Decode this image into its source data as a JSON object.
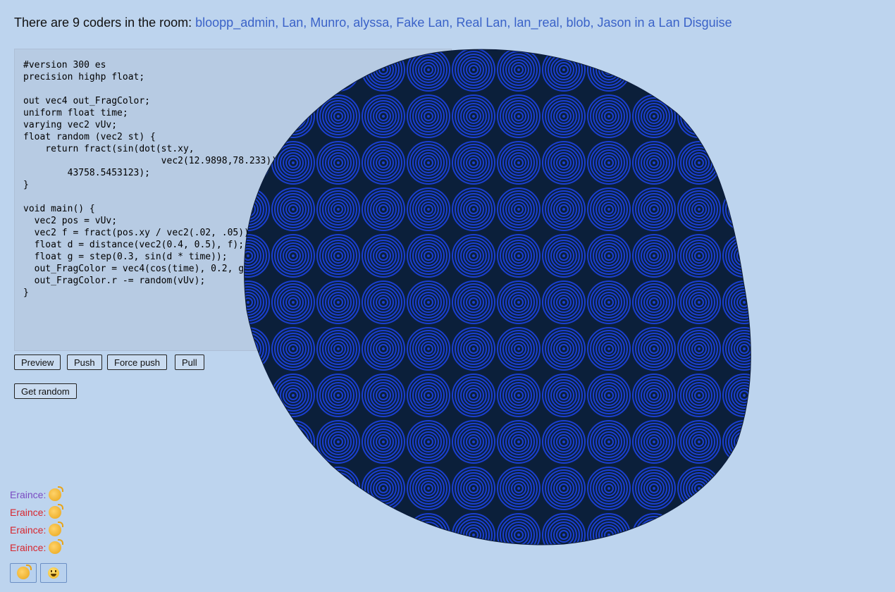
{
  "header": {
    "prefix": "There are 9 coders in the room:",
    "coders": "bloopp_admin, Lan, Munro, alyssa, Fake Lan, Real Lan, lan_real, blob, Jason in a Lan Disguise"
  },
  "editor": {
    "code": "#version 300 es\nprecision highp float;\n\nout vec4 out_FragColor;\nuniform float time;\nvarying vec2 vUv;\nfloat random (vec2 st) {\n    return fract(sin(dot(st.xy,\n                         vec2(12.9898,78.233)))*\n        43758.5453123);\n}\n\nvoid main() {\n  vec2 pos = vUv;\n  vec2 f = fract(pos.xy / vec2(.02, .05));\n  float d = distance(vec2(0.4, 0.5), f);\n  float g = step(0.3, sin(d * time));\n  out_FragColor = vec4(cos(time), 0.2, g, 1.0);\n  out_FragColor.r -= random(vUv);\n}"
  },
  "buttons": {
    "preview": "Preview",
    "push": "Push",
    "force_push": "Force push",
    "pull": "Pull",
    "get_random": "Get random"
  },
  "chat": [
    {
      "user": "Eraince:",
      "color": "#7a4bc2",
      "emoji": "clapping-hands-icon"
    },
    {
      "user": "Eraince:",
      "color": "#d8262e",
      "emoji": "clapping-hands-icon"
    },
    {
      "user": "Eraince:",
      "color": "#d8262e",
      "emoji": "clapping-hands-icon"
    },
    {
      "user": "Eraince:",
      "color": "#d8262e",
      "emoji": "clapping-hands-icon"
    }
  ],
  "reactions": [
    "clapping-hands-icon",
    "grinning-face-icon"
  ],
  "colors": {
    "background": "#bdd4ee",
    "link": "#3a62c8",
    "blob_dark": "#0b1f3a",
    "blob_blue": "#1a3fd0"
  }
}
